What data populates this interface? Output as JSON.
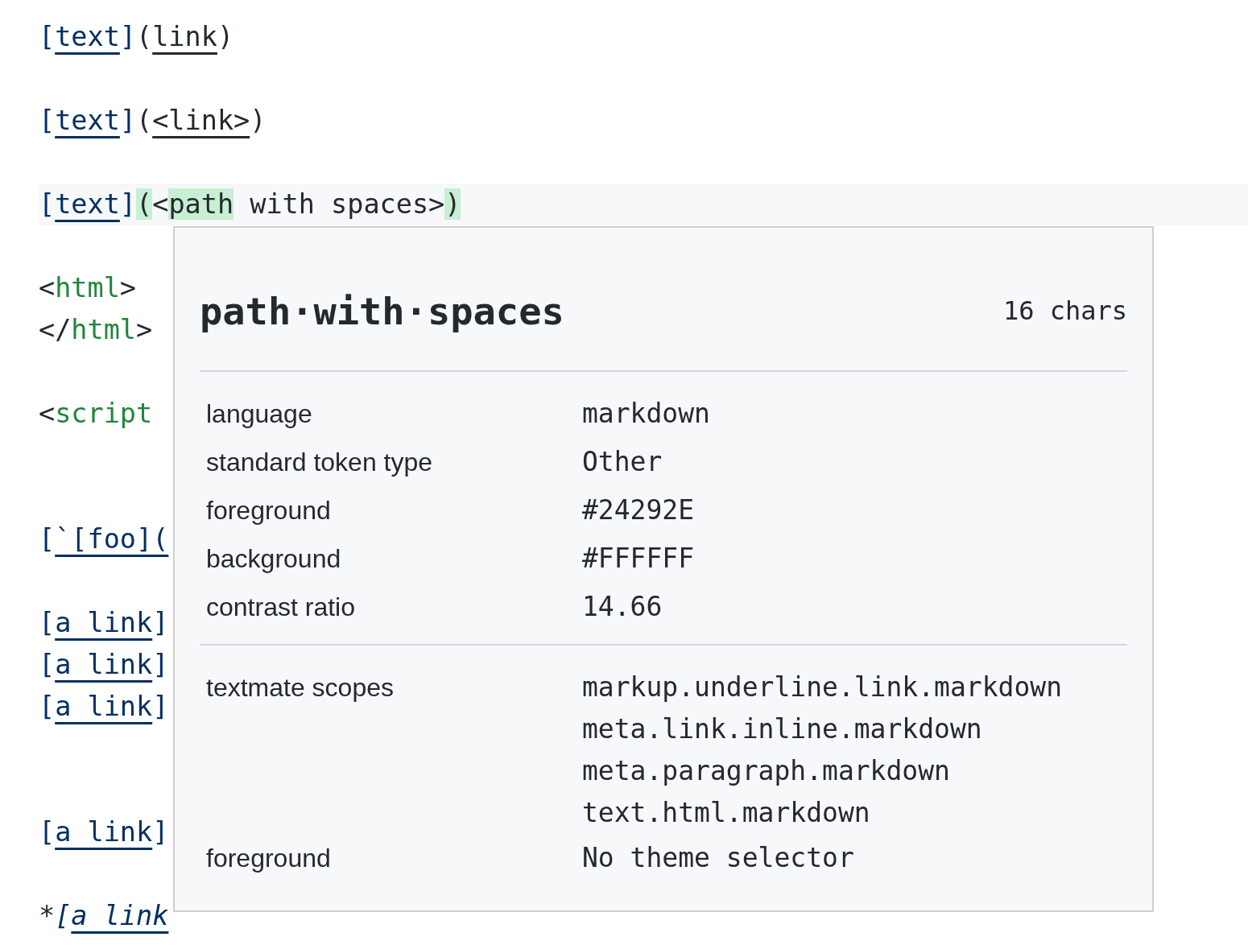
{
  "editor": {
    "lines": [
      {
        "kind": "code",
        "italic": false,
        "tokens": [
          {
            "text": "[",
            "kind": "bracket"
          },
          {
            "text": "text",
            "kind": "label"
          },
          {
            "text": "]",
            "kind": "bracket"
          },
          {
            "text": "(",
            "kind": "punct"
          },
          {
            "text": "link",
            "kind": "url"
          },
          {
            "text": ")",
            "kind": "punct"
          }
        ]
      },
      {
        "kind": "blank"
      },
      {
        "kind": "code",
        "italic": false,
        "tokens": [
          {
            "text": "[",
            "kind": "bracket"
          },
          {
            "text": "text",
            "kind": "label"
          },
          {
            "text": "]",
            "kind": "bracket"
          },
          {
            "text": "(",
            "kind": "punct"
          },
          {
            "text": "<link>",
            "kind": "url"
          },
          {
            "text": ")",
            "kind": "punct"
          }
        ]
      },
      {
        "kind": "blank"
      },
      {
        "kind": "code",
        "current": true,
        "italic": false,
        "tokens": [
          {
            "text": "[",
            "kind": "bracket"
          },
          {
            "text": "text",
            "kind": "label"
          },
          {
            "text": "]",
            "kind": "bracket"
          },
          {
            "text": "(",
            "kind": "match"
          },
          {
            "text": "<",
            "kind": "punct"
          },
          {
            "text": "path",
            "kind": "match"
          },
          {
            "text": " with spaces>",
            "kind": "punct"
          },
          {
            "text": ")",
            "kind": "match"
          }
        ]
      },
      {
        "kind": "blank"
      },
      {
        "kind": "code",
        "italic": false,
        "tokens": [
          {
            "text": "<",
            "kind": "punct"
          },
          {
            "text": "html",
            "kind": "tag"
          },
          {
            "text": ">",
            "kind": "punct"
          }
        ]
      },
      {
        "kind": "code",
        "italic": false,
        "tokens": [
          {
            "text": "</",
            "kind": "punct"
          },
          {
            "text": "html",
            "kind": "tag"
          },
          {
            "text": ">",
            "kind": "punct"
          }
        ]
      },
      {
        "kind": "blank"
      },
      {
        "kind": "code",
        "italic": false,
        "tokens": [
          {
            "text": "<",
            "kind": "punct"
          },
          {
            "text": "script",
            "kind": "tag"
          }
        ]
      },
      {
        "kind": "blank"
      },
      {
        "kind": "blank"
      },
      {
        "kind": "code",
        "italic": false,
        "tokens": [
          {
            "text": "[",
            "kind": "bracket"
          },
          {
            "text": "`[foo](",
            "kind": "label"
          }
        ]
      },
      {
        "kind": "blank"
      },
      {
        "kind": "code",
        "italic": false,
        "tokens": [
          {
            "text": "[",
            "kind": "bracket"
          },
          {
            "text": "a link",
            "kind": "label"
          },
          {
            "text": "]",
            "kind": "bracket"
          }
        ]
      },
      {
        "kind": "code",
        "italic": false,
        "tokens": [
          {
            "text": "[",
            "kind": "bracket"
          },
          {
            "text": "a link",
            "kind": "label"
          },
          {
            "text": "]",
            "kind": "bracket"
          }
        ]
      },
      {
        "kind": "code",
        "italic": false,
        "tokens": [
          {
            "text": "[",
            "kind": "bracket"
          },
          {
            "text": "a link",
            "kind": "label"
          },
          {
            "text": "]",
            "kind": "bracket"
          }
        ]
      },
      {
        "kind": "blank"
      },
      {
        "kind": "blank"
      },
      {
        "kind": "code",
        "italic": false,
        "tokens": [
          {
            "text": "[",
            "kind": "bracket"
          },
          {
            "text": "a link",
            "kind": "label"
          },
          {
            "text": "]",
            "kind": "bracket"
          }
        ]
      },
      {
        "kind": "blank"
      },
      {
        "kind": "code",
        "italic": true,
        "tokens": [
          {
            "text": "*",
            "kind": "punct"
          },
          {
            "text": "[",
            "kind": "bracket"
          },
          {
            "text": "a link",
            "kind": "label"
          }
        ]
      }
    ]
  },
  "hover": {
    "token": "path·with·spaces",
    "length": "16 chars",
    "rows": [
      {
        "label": "language",
        "values": [
          "markdown"
        ]
      },
      {
        "label": "standard token type",
        "values": [
          "Other"
        ]
      },
      {
        "label": "foreground",
        "values": [
          "#24292E"
        ]
      },
      {
        "label": "background",
        "values": [
          "#FFFFFF"
        ]
      },
      {
        "label": "contrast ratio",
        "values": [
          "14.66"
        ]
      }
    ],
    "scope_rows": [
      {
        "label": "textmate scopes",
        "values": [
          "markup.underline.link.markdown",
          "meta.link.inline.markdown",
          "meta.paragraph.markdown",
          "text.html.markdown"
        ]
      },
      {
        "label": "foreground",
        "values": [
          "No theme selector"
        ]
      }
    ]
  }
}
